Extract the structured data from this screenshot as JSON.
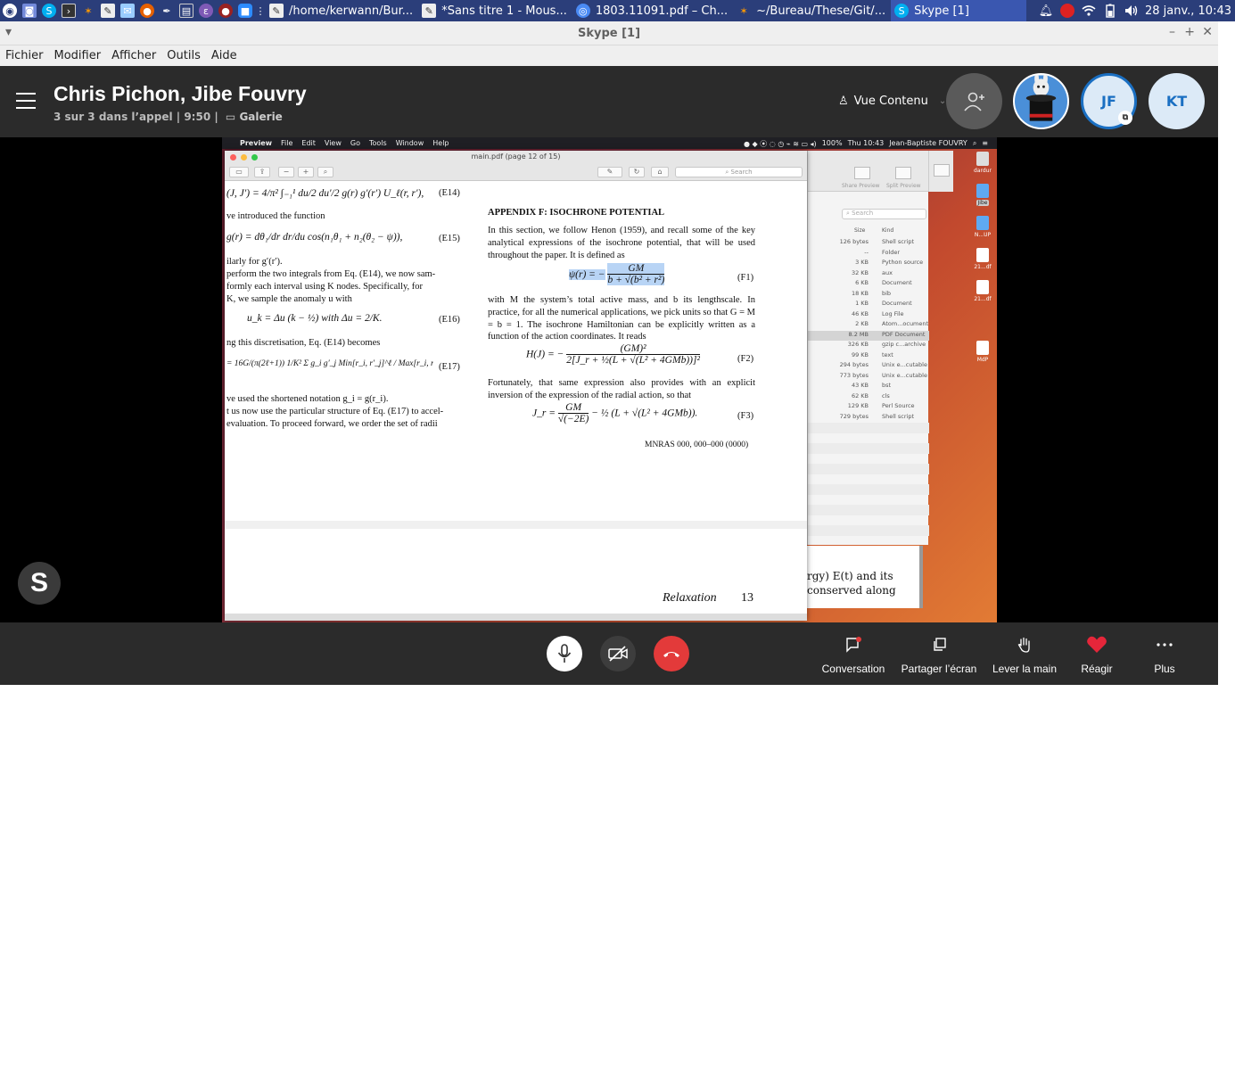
{
  "taskbar": {
    "tasks": [
      {
        "label": "/home/kerwann/Bur..."
      },
      {
        "label": "*Sans titre 1 - Mous..."
      },
      {
        "label": "1803.11091.pdf – Ch..."
      },
      {
        "label": "~/Bureau/These/Git/..."
      },
      {
        "label": "Skype [1]"
      }
    ],
    "clock": "28 janv., 10:43"
  },
  "window": {
    "title": "Skype [1]",
    "menu": [
      "Fichier",
      "Modifier",
      "Afficher",
      "Outils",
      "Aide"
    ]
  },
  "call": {
    "title": "Chris Pichon, Jibe Fouvry",
    "subtitle": "3 sur 3 dans l’appel | 9:50 |",
    "gallery": "Galerie",
    "view_mode": "Vue Contenu",
    "participants": [
      "JF",
      "KT"
    ]
  },
  "shared_screen": {
    "mac_menubar": {
      "app": "Preview",
      "items": [
        "File",
        "Edit",
        "View",
        "Go",
        "Tools",
        "Window",
        "Help"
      ],
      "status": "100%",
      "clock": "Thu 10:43",
      "user": "Jean-Baptiste FOUVRY"
    },
    "preview": {
      "title": "main.pdf (page 12 of 15)",
      "search_placeholder": "Search",
      "left_column": {
        "eq_e14": "(J, J′) = 4/π² ∫₋₁¹ du/2 du′/2 g(r) g′(r′) U_ℓ(r, r′),",
        "eq_e14_num": "(E14)",
        "line1": "ve introduced the function",
        "eq_e15": "g(r) = dθ₁/dr dr/du cos(n₁θ₁ + n₂(θ₂ − ψ)),",
        "eq_e15_num": "(E15)",
        "line2": "ilarly for g′(r′).",
        "p1": [
          "perform the two integrals from Eq. (E14), we now sam-",
          "formly each interval using K nodes. Specifically, for",
          "K, we sample the anomaly u with"
        ],
        "eq_e16": "u_k = Δu (k − ½)   with   Δu = 2/K.",
        "eq_e16_num": "(E16)",
        "line3": "ng this discretisation, Eq. (E14) becomes",
        "eq_e17": "= 16G/(π(2ℓ+1)) 1/K² Σ g_i g′_j Min[r_i, r′_j]^ℓ / Max[r_i, r′_j]^(ℓ+1),",
        "eq_e17_num": "(E17)",
        "p2": [
          "ve used the shortened notation g_i = g(r_i).",
          "t us now use the particular structure of Eq. (E17) to accel-",
          "evaluation. To proceed forward, we order the set of radii"
        ]
      },
      "right_column": {
        "heading": "APPENDIX F:  ISOCHRONE POTENTIAL",
        "p1": "In this section, we follow Henon (1959), and recall some of the key analytical expressions of the isochrone potential, that will be used throughout the paper. It is defined as",
        "eq_f1_lhs": "ψ(r) = −",
        "eq_f1_num_top": "GM",
        "eq_f1_den": "b + √(b² + r²)",
        "eq_f1_num": "(F1)",
        "p2": "with M the system’s total active mass, and b its lengthscale. In practice, for all the numerical applications, we pick units so that G = M = b = 1. The isochrone Hamiltonian can be explicitly written as a function of the action coordinates. It reads",
        "eq_f2_lhs": "H(J) = −",
        "eq_f2_top": "(GM)²",
        "eq_f2_den": "2[J_r + ½(L + √(L² + 4GMb))]²",
        "eq_f2_num": "(F2)",
        "p3": "Fortunately, that same expression also provides with an explicit inversion of the expression of the radial action, so that",
        "eq_f3_lhs": "J_r =",
        "eq_f3_a_top": "GM",
        "eq_f3_a_den": "√(−2E)",
        "eq_f3_rest": "− ½ (L + √(L² + 4GMb)).",
        "eq_f3_num": "(F3)",
        "footer": "MNRAS 000, 000–000 (0000)"
      },
      "next_page": {
        "running_head": "Relaxation",
        "page_number": "13"
      }
    },
    "finder": {
      "search_placeholder": "Search",
      "toolbar_labels": [
        "Share Preview",
        "Split Preview"
      ],
      "col_size": "Size",
      "col_kind": "Kind",
      "rows": [
        {
          "size": "126 bytes",
          "kind": "Shell script"
        },
        {
          "size": "--",
          "kind": "Folder"
        },
        {
          "size": "3 KB",
          "kind": "Python source"
        },
        {
          "size": "32 KB",
          "kind": "aux"
        },
        {
          "size": "6 KB",
          "kind": "Document"
        },
        {
          "size": "18 KB",
          "kind": "bib"
        },
        {
          "size": "1 KB",
          "kind": "Document"
        },
        {
          "size": "46 KB",
          "kind": "Log File"
        },
        {
          "size": "2 KB",
          "kind": "Atom...ocument"
        },
        {
          "size": "8.2 MB",
          "kind": "PDF Document"
        },
        {
          "size": "326 KB",
          "kind": "gzip c...archive"
        },
        {
          "size": "99 KB",
          "kind": "text"
        },
        {
          "size": "294 bytes",
          "kind": "Unix e...cutable"
        },
        {
          "size": "773 bytes",
          "kind": "Unix e...cutable"
        },
        {
          "size": "43 KB",
          "kind": "bst"
        },
        {
          "size": "62 KB",
          "kind": "cls"
        },
        {
          "size": "129 KB",
          "kind": "Perl Source"
        },
        {
          "size": "729 bytes",
          "kind": "Shell script"
        }
      ]
    },
    "dock": [
      "dardur",
      "Jibe",
      "N...UP",
      "21...df",
      "21...df",
      "MdP"
    ],
    "behind_doc": {
      "line1": "rgy) E(t) and its",
      "line2": "conserved along"
    }
  },
  "skype_logo_letter": "S",
  "controls": {
    "actions": [
      {
        "label": "Conversation",
        "icon": "chat-icon"
      },
      {
        "label": "Partager l’écran",
        "icon": "share-screen-icon"
      },
      {
        "label": "Lever la main",
        "icon": "raise-hand-icon"
      },
      {
        "label": "Réagir",
        "icon": "heart-icon"
      },
      {
        "label": "Plus",
        "icon": "more-icon"
      }
    ]
  },
  "colors": {
    "taskbar": "#2b3e7a",
    "header": "#2b2b2b",
    "hangup": "#e33a3a",
    "accent": "#1a6fc2",
    "react_heart": "#e5263a"
  }
}
